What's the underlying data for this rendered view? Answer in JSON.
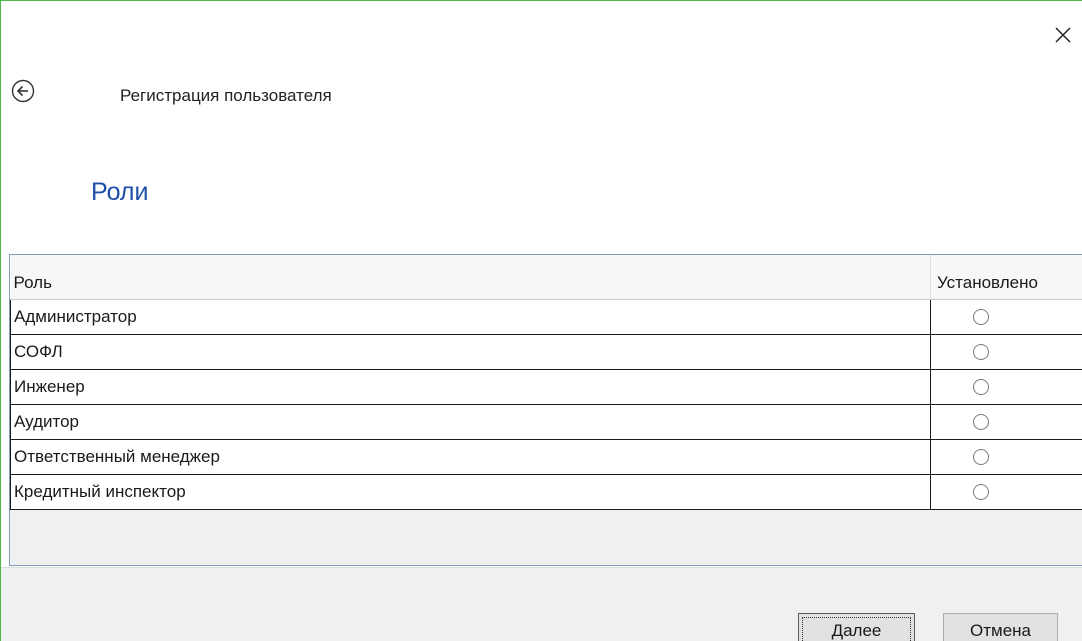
{
  "window": {
    "title": "Регистрация пользователя",
    "close_icon": "close-icon",
    "back_icon": "back-arrow-icon"
  },
  "section": {
    "title": "Роли"
  },
  "grid": {
    "columns": [
      "Роль",
      "Установлено"
    ],
    "rows": [
      {
        "role": "Администратор",
        "set": false
      },
      {
        "role": "СОФЛ",
        "set": false
      },
      {
        "role": "Инженер",
        "set": false
      },
      {
        "role": "Аудитор",
        "set": false
      },
      {
        "role": "Ответственный менеджер",
        "set": false
      },
      {
        "role": "Кредитный инспектор",
        "set": false
      }
    ]
  },
  "footer": {
    "next_label": "Далее",
    "cancel_label": "Отмена"
  },
  "colors": {
    "accent": "#1f4fa8",
    "window_border": "#4cb84c"
  }
}
